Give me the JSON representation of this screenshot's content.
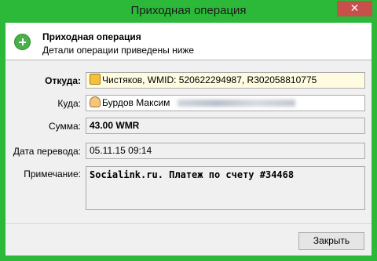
{
  "window": {
    "title": "Приходная операция",
    "close_glyph": "✕"
  },
  "header": {
    "title": "Приходная операция",
    "subtitle": "Детали операции приведены ниже",
    "icon": "plus-circle-icon"
  },
  "fields": {
    "from": {
      "label": "Откуда:",
      "value": "Чистяков, WMID: 520622294987, R302058810775",
      "icon": "wallet-icon"
    },
    "to": {
      "label": "Куда:",
      "value": "Бурдов Максим",
      "icon": "person-icon"
    },
    "amount": {
      "label": "Сумма:",
      "value": "43.00 WMR"
    },
    "date": {
      "label": "Дата перевода:",
      "value": "05.11.15 09:14"
    },
    "note": {
      "label": "Примечание:",
      "value": "Socialink.ru. Платеж по счету #34468"
    }
  },
  "footer": {
    "close_label": "Закрыть"
  },
  "colors": {
    "titlebar": "#2cb939",
    "close_button": "#c7504a",
    "from_field_bg": "#fffbe0"
  }
}
